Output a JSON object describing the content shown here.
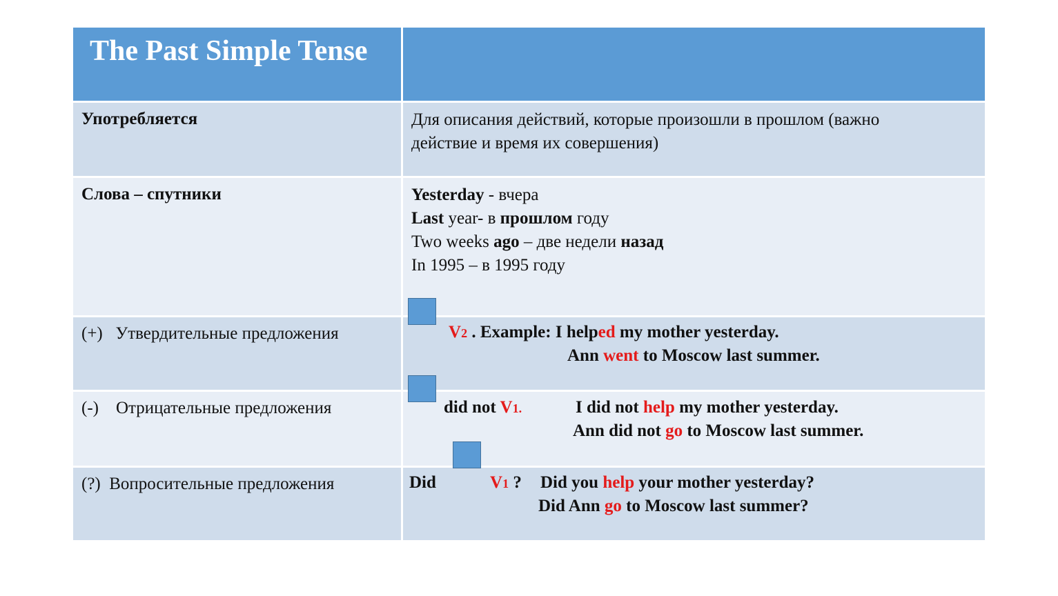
{
  "title": "The Past Simple Tense",
  "rows": [
    {
      "label": "Употребляется",
      "lines": [
        "Для описания действий, которые произошли в прошлом (важно",
        "действие и время их совершения)"
      ]
    },
    {
      "label": "Слова – спутники",
      "markers": [
        {
          "word": "Yesterday",
          "rest": " - вчера"
        },
        {
          "word": "Last",
          "mid": " year-  в ",
          "word2": "прошлом",
          "rest": " году"
        },
        {
          "pre": "Two weeks ",
          "word": "ago",
          "mid": " – две недели ",
          "word2": "назад"
        },
        {
          "pre": "In 1995 – в 1995 году"
        }
      ]
    },
    {
      "label_prefix": "(+)",
      "label": "Утвердительные предложения",
      "formula": {
        "verb": "V",
        "sub": "2",
        "rest": " . Example: I help",
        "ending": "ed",
        "tail": " my mother yesterday."
      },
      "example2": {
        "pre": "Ann ",
        "verb": "went",
        "post": " to Moscow last summer."
      }
    },
    {
      "label_prefix": "(-)",
      "label": "Отрицательные предложения",
      "formula": {
        "aux": "did not ",
        "verb": "V",
        "sub": "1."
      },
      "example1": {
        "pre": "I did not ",
        "verb": "help",
        "post": " my mother yesterday."
      },
      "example2": {
        "pre": "Ann did not ",
        "verb": "go",
        "post": " to Moscow last summer."
      }
    },
    {
      "label_prefix": "(?)",
      "label": "Вопросительные предложения",
      "formula": {
        "aux": "Did",
        "verb": "V",
        "sub": "1",
        "q": " ?"
      },
      "example1": {
        "pre": "Did you ",
        "verb": "help",
        "post": " your mother yesterday?"
      },
      "example2": {
        "pre": "Did Ann ",
        "verb": "go",
        "post": " to Moscow last summer?"
      }
    }
  ],
  "colors": {
    "header": "#5b9bd5",
    "row_dark": "#cfdceb",
    "row_light": "#e8eef6",
    "accent_red": "#e41b1b"
  }
}
